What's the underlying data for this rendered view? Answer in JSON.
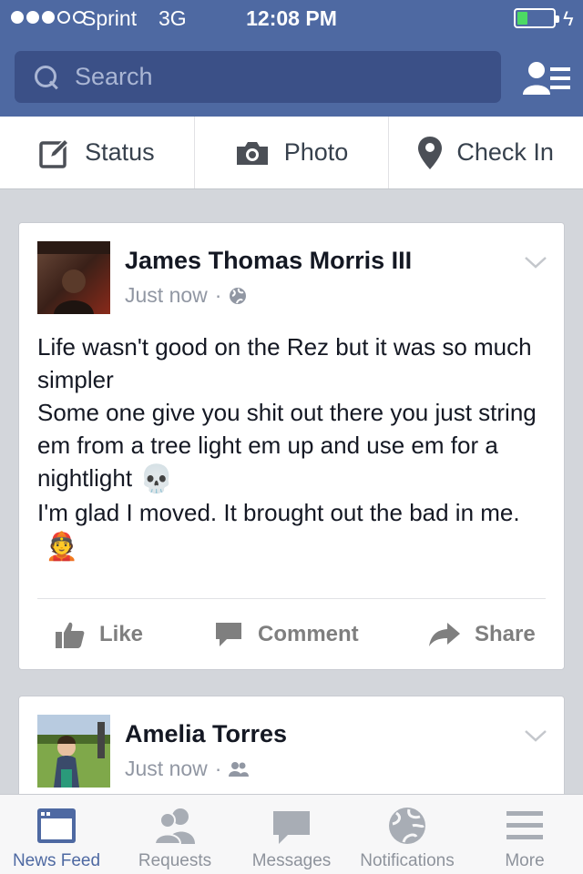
{
  "status_bar": {
    "signal_bars": 3,
    "carrier": "Sprint",
    "network": "3G",
    "time": "12:08 PM",
    "battery_level": 0.3,
    "battery_color": "#4cd964"
  },
  "header": {
    "search_placeholder": "Search",
    "background_color": "#4e69a2",
    "icons": [
      "search-icon",
      "friends-list-icon"
    ]
  },
  "composer": {
    "status_label": "Status",
    "photo_label": "Photo",
    "checkin_label": "Check In",
    "icons": [
      "edit-icon",
      "camera-icon",
      "location-pin-icon"
    ]
  },
  "feed": [
    {
      "author": "James Thomas Morris III",
      "timestamp": "Just now",
      "separator": "·",
      "audience_icon": "globe-icon",
      "paragraphs": [
        "Life wasn't good on the Rez but it was so much simpler",
        "Some one give you shit out there you just string em from a tree light em up and use em for a nightlight",
        "I'm glad I moved. It brought out the bad in me."
      ],
      "emojis": [
        "💀",
        "👲"
      ],
      "actions": {
        "like": "Like",
        "comment": "Comment",
        "share": "Share"
      }
    },
    {
      "author": "Amelia Torres",
      "timestamp": "Just now",
      "separator": "·",
      "audience_icon": "friends-icon"
    }
  ],
  "tabbar": {
    "tabs": [
      {
        "label": "News Feed",
        "icon": "news-feed-icon",
        "active": true
      },
      {
        "label": "Requests",
        "icon": "friend-requests-icon",
        "active": false
      },
      {
        "label": "Messages",
        "icon": "messages-icon",
        "active": false
      },
      {
        "label": "Notifications",
        "icon": "notifications-globe-icon",
        "active": false
      },
      {
        "label": "More",
        "icon": "menu-icon",
        "active": false
      }
    ],
    "active_color": "#4e69a2",
    "inactive_color": "#8e939c"
  }
}
